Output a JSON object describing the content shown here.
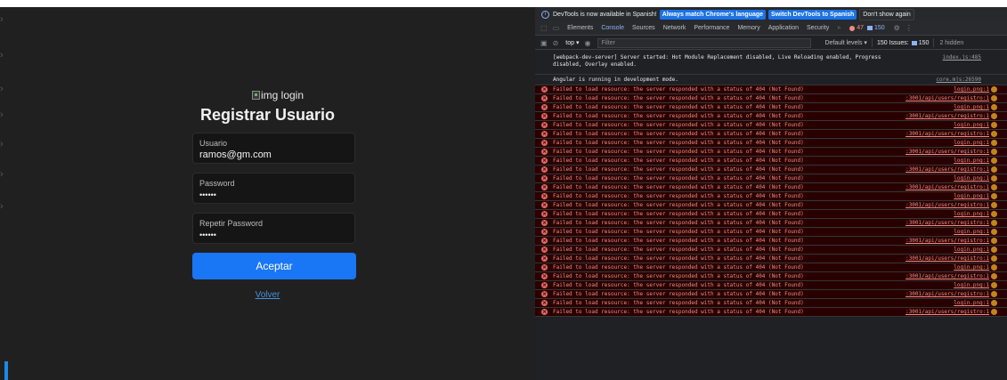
{
  "app": {
    "logo_alt": "img login",
    "title": "Registrar Usuario",
    "fields": [
      {
        "label": "Usuario",
        "value": "ramos@gm.com"
      },
      {
        "label": "Password",
        "value": "••••••"
      },
      {
        "label": "Repetir Password",
        "value": "••••••"
      }
    ],
    "submit_label": "Aceptar",
    "back_link": "Volver"
  },
  "devtools": {
    "infobar": {
      "message": "DevTools is now available in Spanish!",
      "btn_match": "Always match Chrome's language",
      "btn_switch": "Switch DevTools to Spanish",
      "btn_dismiss": "Don't show again"
    },
    "tabs": [
      "Elements",
      "Console",
      "Sources",
      "Network",
      "Performance",
      "Memory",
      "Application",
      "Security"
    ],
    "active_tab": "Console",
    "more_tabs": "»",
    "error_count": "47",
    "warning_count": "150",
    "toolbar": {
      "context": "top ▾",
      "filter_placeholder": "Filter",
      "levels": "Default levels ▾",
      "issues_label": "150 Issues:",
      "issues_count": "150",
      "hidden": "2 hidden"
    },
    "info_logs": [
      {
        "message": "[webpack-dev-server] Server started: Hot Module Replacement disabled, Live Reloading enabled, Progress disabled, Overlay enabled.",
        "source": "index.js:485"
      },
      {
        "message": "Angular is running in development mode.",
        "source": "core.mjs:26590"
      }
    ],
    "error_message": "Failed to load resource: the server responded with a status of 404 (Not Found)",
    "error_sources": [
      "login.png:1",
      ":3001/api/users/registro:1"
    ],
    "error_row_count": 26,
    "colors": {
      "error_bg": "#290000",
      "error_text": "#f28b82",
      "accent": "#1976f5"
    }
  }
}
